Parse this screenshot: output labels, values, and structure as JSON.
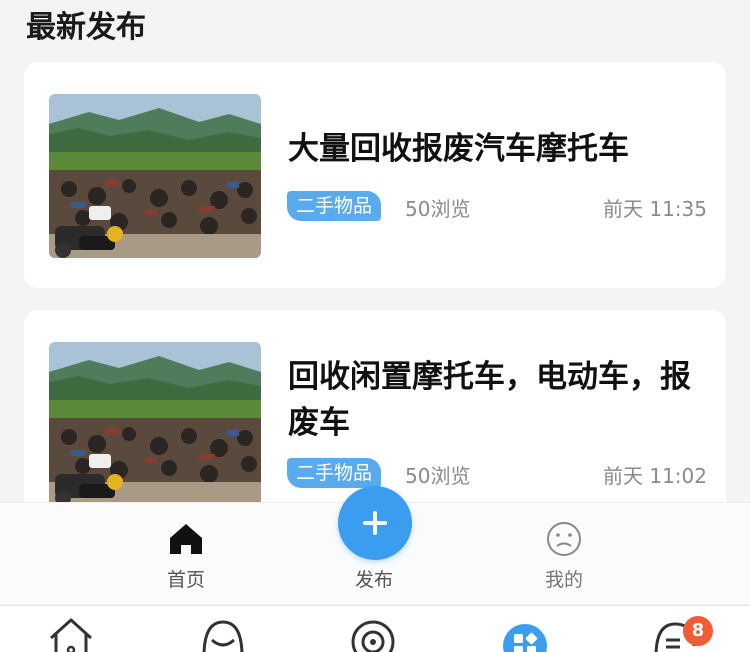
{
  "section": {
    "title": "最新发布"
  },
  "posts": [
    {
      "title": "大量回收报废汽车摩托车",
      "tag": "二手物品",
      "views": "50浏览",
      "time": "前天 11:35"
    },
    {
      "title": "回收闲置摩托车，电动车，报废车",
      "tag": "二手物品",
      "views": "50浏览",
      "time": "前天 11:02"
    }
  ],
  "tabbar": {
    "home_label": "首页",
    "publish_label": "发布",
    "mine_label": "我的"
  },
  "system_bar": {
    "message_badge": "8"
  },
  "colors": {
    "accent": "#3a9df0",
    "tag_bg": "#5aabee",
    "badge": "#f25c35"
  },
  "icons": [
    "home-icon",
    "add-icon",
    "sad-face-icon",
    "sys-home-icon",
    "sys-face-icon",
    "sys-target-icon",
    "sys-apps-icon",
    "sys-message-icon"
  ]
}
